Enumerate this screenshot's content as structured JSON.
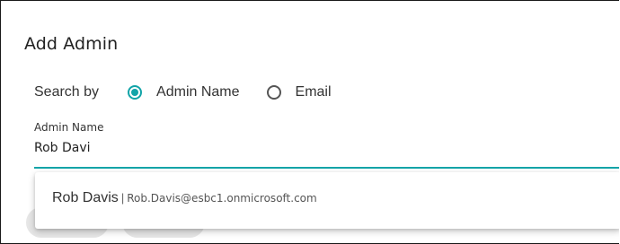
{
  "dialog": {
    "title": "Add Admin"
  },
  "search_by": {
    "label": "Search by",
    "options": [
      {
        "label": "Admin Name",
        "selected": true
      },
      {
        "label": "Email",
        "selected": false
      }
    ]
  },
  "field": {
    "label": "Admin Name",
    "value": "Rob Davi"
  },
  "suggestion": {
    "name": "Rob Davis",
    "separator": "|",
    "email": "Rob.Davis@esbc1.onmicrosoft.com"
  },
  "colors": {
    "accent": "#12a4a8"
  }
}
